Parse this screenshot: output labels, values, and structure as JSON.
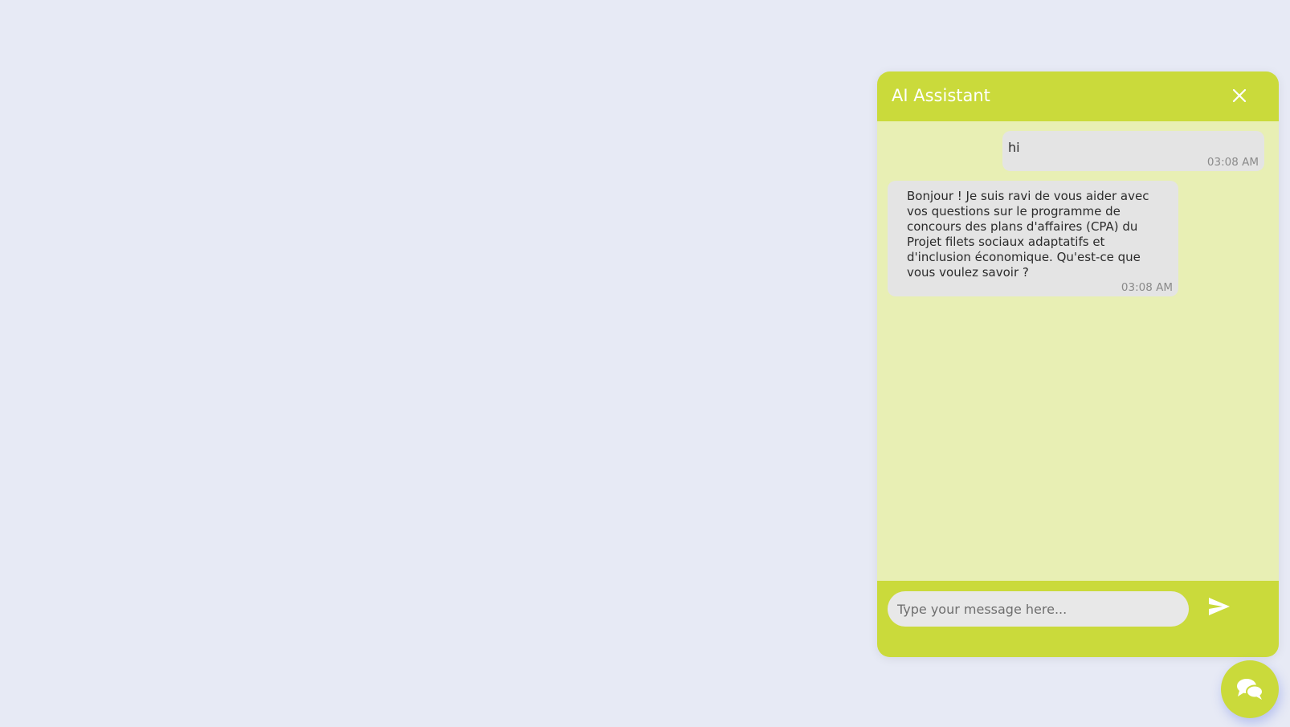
{
  "chat": {
    "title": "AI Assistant",
    "input_placeholder": "Type your message here...",
    "messages": [
      {
        "sender": "user",
        "text": "hi",
        "time": "03:08 AM"
      },
      {
        "sender": "assistant",
        "text": "Bonjour ! Je suis ravi de vous aider avec vos questions sur le programme de concours des plans d'affaires (CPA) du Projet filets sociaux adaptatifs et d'inclusion économique. Qu'est-ce que vous voulez savoir ?",
        "time": "03:08 AM"
      }
    ]
  },
  "icons": {
    "close": "close-icon",
    "send": "send-icon",
    "launcher": "chat-bubbles-icon"
  },
  "colors": {
    "page_background": "#e7eaf5",
    "accent": "#cada3b",
    "panel_background": "#e8efb4",
    "bubble_background": "#e4e4e4"
  }
}
